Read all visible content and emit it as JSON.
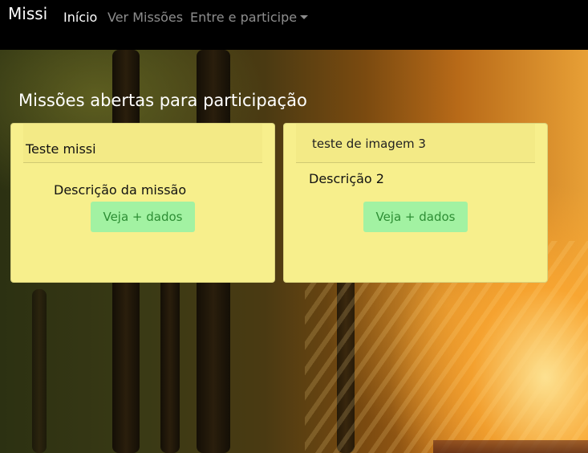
{
  "navbar": {
    "brand": "Missi",
    "links": [
      "Início",
      "Ver Missões",
      "Entre e participe"
    ]
  },
  "page": {
    "heading": "Missões abertas para participação"
  },
  "cards": [
    {
      "title": "Teste missi",
      "description": "Descrição da missão",
      "button": "Veja + dados"
    },
    {
      "title": "teste de imagem 3",
      "description": "Descrição 2",
      "button": "Veja + dados"
    }
  ],
  "colors": {
    "navbar_bg": "#000000",
    "card_bg": "#f7ef8c",
    "button_bg": "#a2f2a2",
    "button_text": "#2d8e34"
  }
}
